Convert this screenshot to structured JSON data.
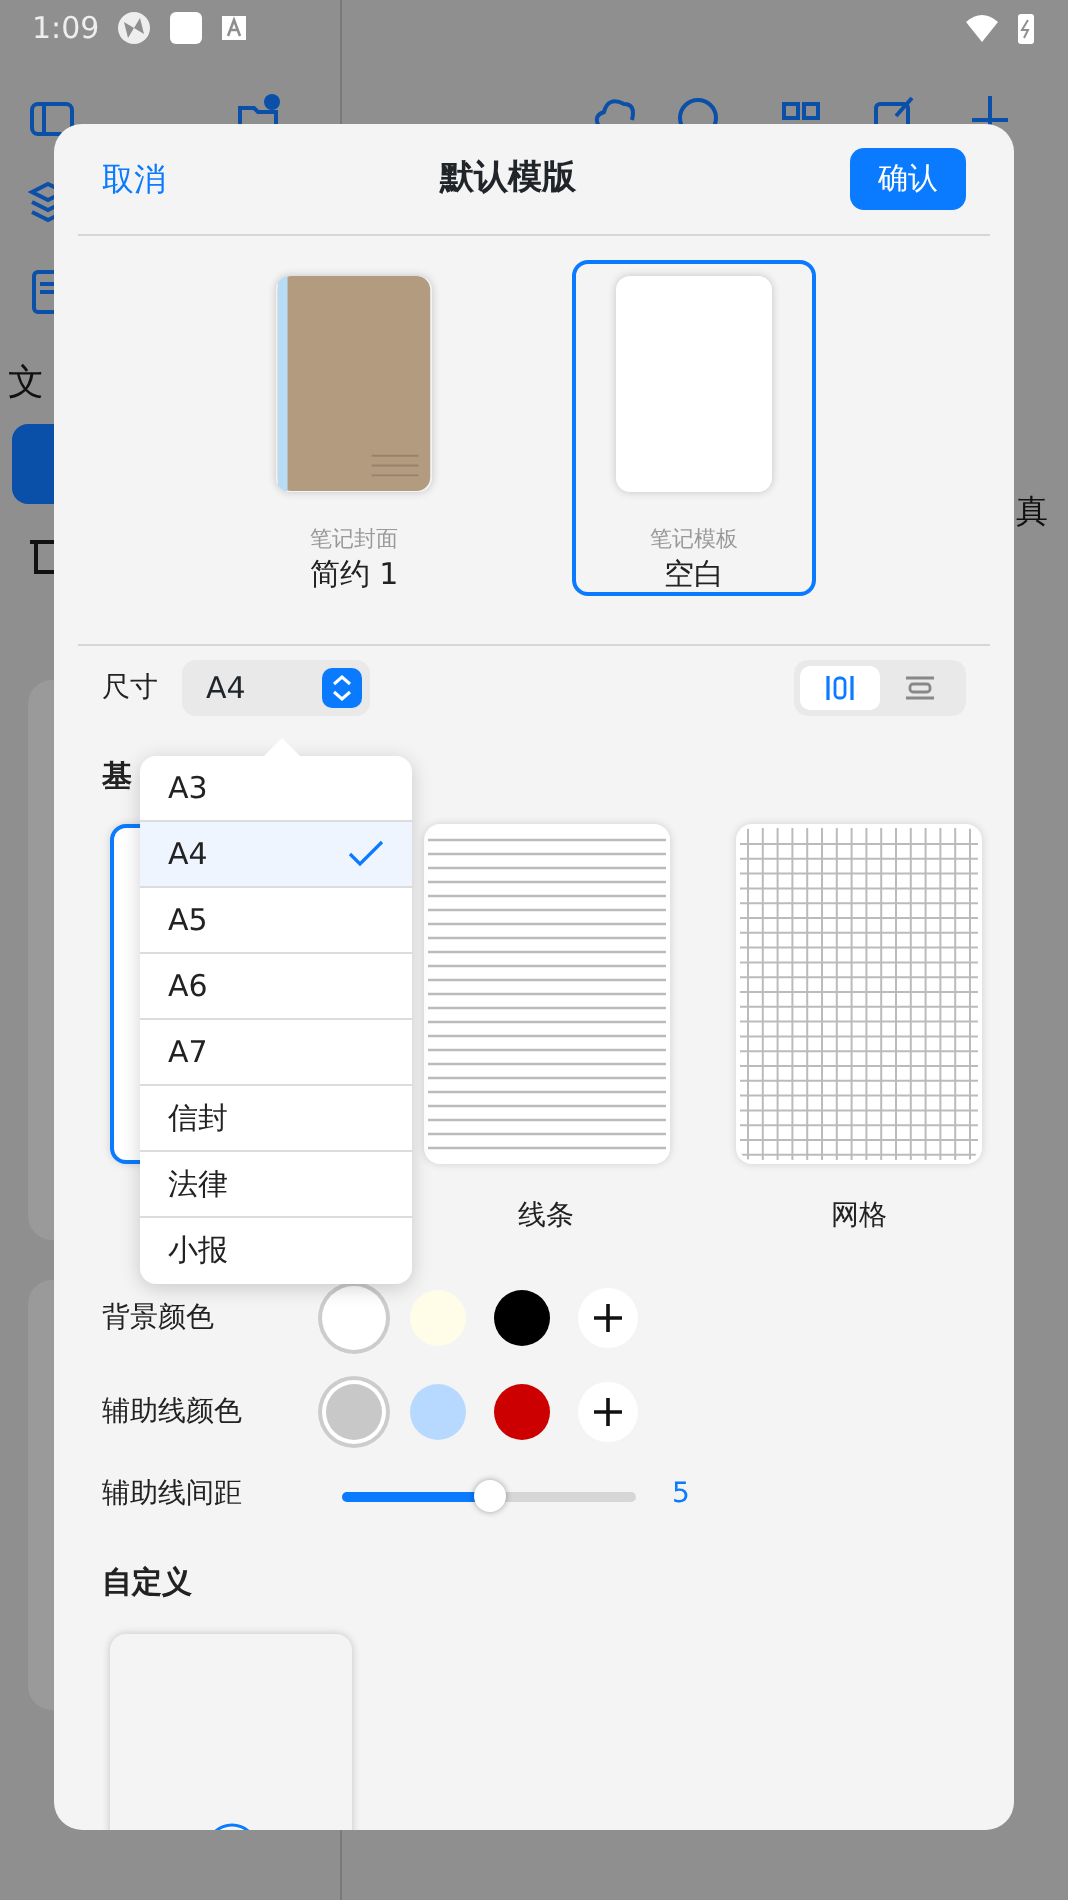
{
  "status_bar": {
    "time": "1:09"
  },
  "background": {
    "sidebar_text": "文",
    "content_text": "真"
  },
  "dialog": {
    "cancel": "取消",
    "title": "默认模版",
    "confirm": "确认",
    "covers": [
      {
        "kind": "cover",
        "caption": "笔记封面",
        "name": "简约 1",
        "selected": false
      },
      {
        "kind": "blank",
        "caption": "笔记模板",
        "name": "空白",
        "selected": true
      }
    ],
    "size": {
      "label": "尺寸",
      "value": "A4"
    },
    "orientation": [
      {
        "kind": "portrait",
        "selected": true
      },
      {
        "kind": "landscape",
        "selected": false
      }
    ],
    "basic_heading": "基",
    "templates": [
      {
        "kind": "blank",
        "selected": true
      },
      {
        "kind": "lines",
        "label": "线条",
        "selected": false
      },
      {
        "kind": "grid",
        "label": "网格",
        "selected": false
      }
    ],
    "background_color": {
      "label": "背景颜色",
      "swatches": [
        {
          "color": "#ffffff",
          "selected": true
        },
        {
          "color": "#fffde8",
          "selected": false
        },
        {
          "color": "#000000",
          "selected": false
        }
      ]
    },
    "guide_color": {
      "label": "辅助线颜色",
      "swatches": [
        {
          "color": "#c8c8c8",
          "selected": true
        },
        {
          "color": "#b8d9ff",
          "selected": false
        },
        {
          "color": "#cc0000",
          "selected": false
        }
      ]
    },
    "guide_spacing": {
      "label": "辅助线间距",
      "level": 0.5,
      "reading": "5"
    },
    "custom_heading": "自定义"
  },
  "size_menu": [
    {
      "label": "A3",
      "selected": false
    },
    {
      "label": "A4",
      "selected": true
    },
    {
      "label": "A5",
      "selected": false
    },
    {
      "label": "A6",
      "selected": false
    },
    {
      "label": "A7",
      "selected": false
    },
    {
      "label": "信封",
      "selected": false
    },
    {
      "label": "法律",
      "selected": false
    },
    {
      "label": "小报",
      "selected": false
    }
  ]
}
